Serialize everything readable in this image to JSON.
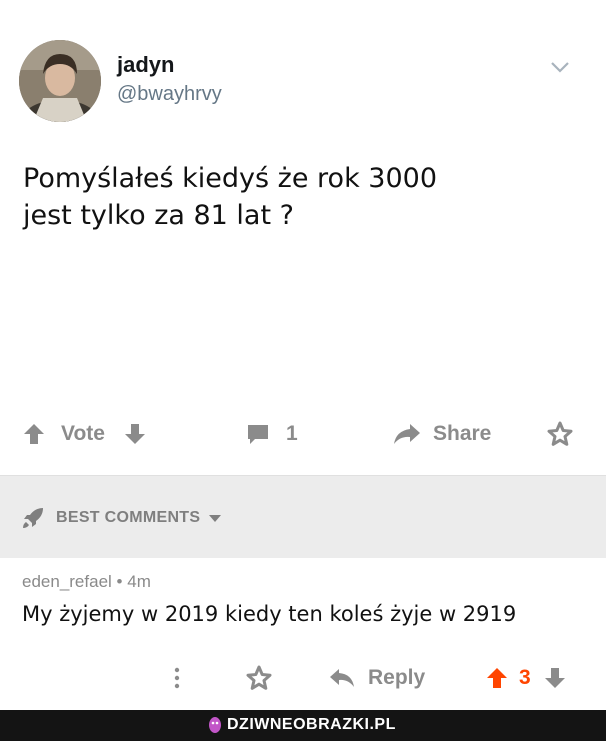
{
  "tweet": {
    "username": "jadyn",
    "handle": "@bwayhrvy",
    "text_line1": "Pomyślałeś kiedyś że rok 3000",
    "text_line2": "jest tylko za 81 lat ?"
  },
  "actions": {
    "vote_label": "Vote",
    "comment_count": "1",
    "share_label": "Share"
  },
  "comments_header": {
    "label": "BEST COMMENTS"
  },
  "comment": {
    "author": "eden_refael",
    "separator": "•",
    "age": "4m",
    "text": "My żyjemy w 2019 kiedy ten koleś żyje w 2919",
    "reply_label": "Reply",
    "score": "3"
  },
  "watermark": {
    "text": "DZIWNEOBRAZKI.PL"
  },
  "colors": {
    "upvote_orange": "#ff4500",
    "icon_gray": "#8b8b8b",
    "section_bg": "#ececec"
  },
  "icons": [
    "chevron-down-icon",
    "upvote-arrow-icon",
    "downvote-arrow-icon",
    "comment-bubble-icon",
    "share-arrow-icon",
    "save-star-icon",
    "rocket-icon",
    "caret-down-icon",
    "more-vertical-icon",
    "reply-arrow-icon",
    "watermark-logo-icon"
  ]
}
